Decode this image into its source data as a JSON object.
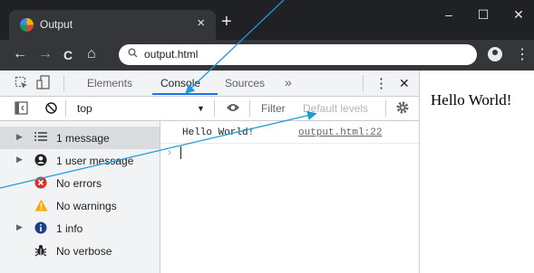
{
  "window": {
    "tab_title": "Output",
    "tab_close": "×",
    "new_tab": "+",
    "minimize": "–",
    "maximize": "☐",
    "close": "✕"
  },
  "toolbar": {
    "back": "←",
    "forward": "→",
    "reload": "C",
    "home": "⌂",
    "url": "output.html",
    "menu": "⋮"
  },
  "devtools": {
    "tabs": [
      "Elements",
      "Console",
      "Sources",
      "»"
    ],
    "active_tab": "Console",
    "menu": "⋮",
    "close": "✕",
    "context": "top",
    "filter_label": "Filter",
    "levels_placeholder": "Default levels"
  },
  "sidebar": {
    "items": [
      {
        "label": "1 message",
        "icon": "list-icon",
        "expandable": true,
        "selected": true
      },
      {
        "label": "1 user message",
        "icon": "user-icon",
        "expandable": true
      },
      {
        "label": "No errors",
        "icon": "error-icon",
        "expandable": false
      },
      {
        "label": "No warnings",
        "icon": "warning-icon",
        "expandable": false
      },
      {
        "label": "1 info",
        "icon": "info-icon",
        "expandable": true
      },
      {
        "label": "No verbose",
        "icon": "bug-icon",
        "expandable": false
      }
    ]
  },
  "console": {
    "message": "Hello World!",
    "source": "output.html:22",
    "prompt": "›"
  },
  "page": {
    "text": "Hello World!"
  },
  "colors": {
    "chrome_dark": "#202124",
    "toolbar": "#35363a",
    "accent_blue": "#1a73e8",
    "arrow": "#1e9ad6",
    "error_red": "#d93025",
    "warning_yellow": "#f9ab00",
    "info_blue": "#1a73e8"
  }
}
